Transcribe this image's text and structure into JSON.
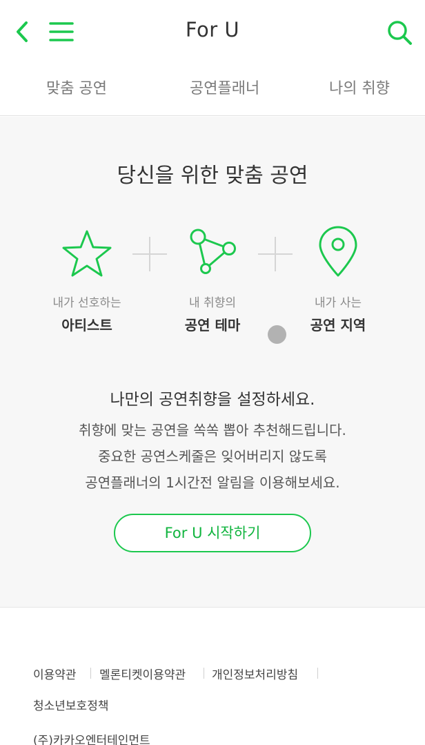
{
  "header": {
    "title": "For U"
  },
  "tabs": [
    {
      "label": "맞춤 공연"
    },
    {
      "label": "공연플래너"
    },
    {
      "label": "나의 취향"
    }
  ],
  "main": {
    "headline": "당신을 위한 맞춤 공연",
    "steps": [
      {
        "small": "내가 선호하는",
        "bold": "아티스트",
        "icon": "star-icon"
      },
      {
        "small": "내 취향의",
        "bold": "공연 테마",
        "icon": "theme-network-icon"
      },
      {
        "small": "내가 사는",
        "bold": "공연 지역",
        "icon": "location-pin-icon"
      }
    ],
    "desc_title": "나만의 공연취향을 설정하세요.",
    "desc_lines": [
      "취향에 맞는 공연을 쏙쏙 뽑아 추천해드립니다.",
      "중요한 공연스케줄은 잊어버리지 않도록",
      "공연플래너의 1시간전 알림을 이용해보세요."
    ],
    "start_button": "For U 시작하기"
  },
  "footer": {
    "links": [
      "이용약관",
      "멜론티켓이용약관",
      "개인정보처리방침",
      "청소년보호정책"
    ],
    "company": "(주)카카오엔터테인먼트"
  },
  "colors": {
    "accent": "#1cc84e",
    "plus_gray": "#d5d5d5"
  }
}
